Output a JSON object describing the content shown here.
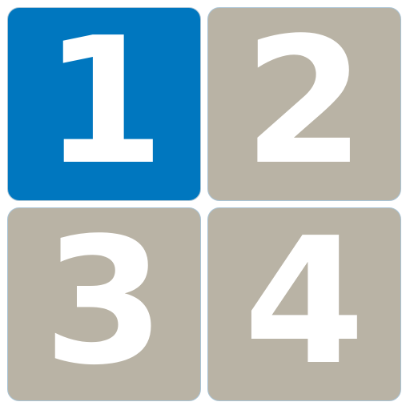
{
  "tiles": [
    {
      "label": "1",
      "color": "#0077bf",
      "selected": true
    },
    {
      "label": "2",
      "color": "#b9b3a5",
      "selected": false
    },
    {
      "label": "3",
      "color": "#b9b3a5",
      "selected": false
    },
    {
      "label": "4",
      "color": "#b9b3a5",
      "selected": false
    }
  ]
}
